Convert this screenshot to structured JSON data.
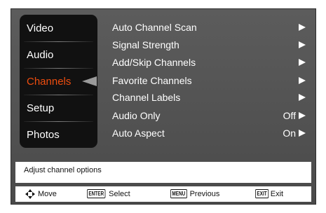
{
  "sidebar": {
    "items": [
      {
        "label": "Video"
      },
      {
        "label": "Audio"
      },
      {
        "label": "Channels"
      },
      {
        "label": "Setup"
      },
      {
        "label": "Photos"
      }
    ],
    "selected": "Channels",
    "selected_color": "#ee4d0f"
  },
  "options": [
    {
      "label": "Auto Channel Scan",
      "value": ""
    },
    {
      "label": "Signal Strength",
      "value": ""
    },
    {
      "label": "Add/Skip Channels",
      "value": ""
    },
    {
      "label": "Favorite Channels",
      "value": ""
    },
    {
      "label": "Channel Labels",
      "value": ""
    },
    {
      "label": "Audio Only",
      "value": "Off"
    },
    {
      "label": "Auto Aspect",
      "value": "On"
    }
  ],
  "help_text": "Adjust channel options",
  "footer": {
    "move_label": "Move",
    "enter_key": "ENTER",
    "select_label": "Select",
    "menu_key": "MENU",
    "previous_label": "Previous",
    "exit_key": "EXIT",
    "exit_label": "Exit"
  },
  "icons": [
    "directional-pad-icon",
    "arrow-right-icon"
  ]
}
